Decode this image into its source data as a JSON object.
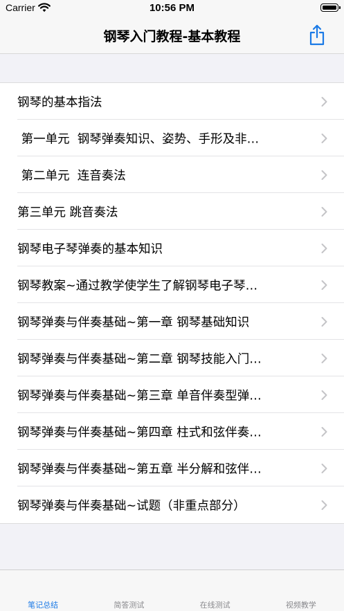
{
  "status_bar": {
    "carrier": "Carrier",
    "time": "10:56 PM"
  },
  "nav": {
    "title": "钢琴入门教程-基本教程",
    "share_icon": "share-icon",
    "accent_color": "#1b7ae6"
  },
  "list": {
    "items": [
      "钢琴的基本指法",
      " 第一单元  钢琴弹奏知识、姿势、手形及非…",
      " 第二单元  连音奏法",
      "第三单元 跳音奏法",
      "钢琴电子琴弹奏的基本知识",
      "钢琴教案~通过教学使学生了解钢琴电子琴…",
      "钢琴弹奏与伴奏基础~第一章 钢琴基础知识",
      "钢琴弹奏与伴奏基础~第二章 钢琴技能入门…",
      "钢琴弹奏与伴奏基础~第三章 单音伴奏型弹…",
      "钢琴弹奏与伴奏基础~第四章 柱式和弦伴奏…",
      "钢琴弹奏与伴奏基础~第五章 半分解和弦伴…",
      "钢琴弹奏与伴奏基础~试题（非重点部分）"
    ]
  },
  "tabs": {
    "items": [
      "笔记总结",
      "简答测试",
      "在线测试",
      "视频教学"
    ],
    "active_index": 0
  }
}
